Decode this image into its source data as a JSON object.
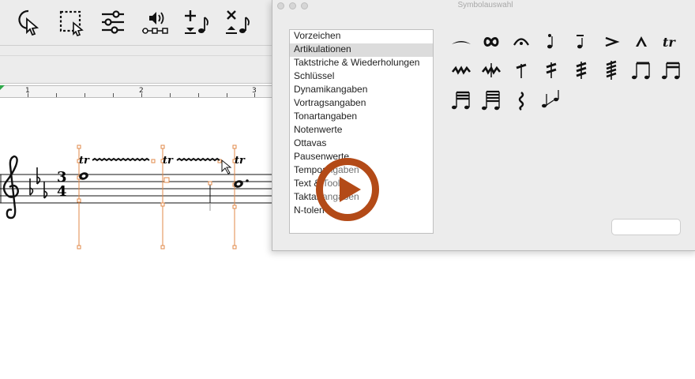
{
  "toolbar": {
    "tools": [
      {
        "icon": "cursor-select-icon"
      },
      {
        "icon": "marquee-select-icon"
      },
      {
        "icon": "sliders-icon"
      },
      {
        "icon": "playback-volume-icon"
      },
      {
        "icon": "add-note-icon"
      },
      {
        "icon": "delete-note-icon"
      }
    ]
  },
  "ruler": {
    "measures": [
      "1",
      "2",
      "3"
    ]
  },
  "score": {
    "trill_label": "tr",
    "time_signature_top": "3",
    "time_signature_bottom": "4",
    "selection_color": "#e08a4a"
  },
  "palette": {
    "title": "Symbolauswahl",
    "categories": [
      "Vorzeichen",
      "Artikulationen",
      "Taktstriche & Wiederholungen",
      "Schlüssel",
      "Dynamikangaben",
      "Vortragsangaben",
      "Tonartangaben",
      "Notenwerte",
      "Ottavas",
      "Pausenwerte",
      "Tempoangaben",
      "Text & Tools",
      "Taktartangaben",
      "N-tolen"
    ],
    "selected_category": "Artikulationen",
    "symbols": [
      "slur-icon",
      "turn-icon",
      "fermata-icon",
      "staccato-icon",
      "tenuto-icon",
      "accent-icon",
      "marcato-icon",
      "trill-icon",
      "short-trill-icon",
      "mordent-icon",
      "tremolo-one-stroke-icon",
      "tremolo-two-strokes-icon",
      "tremolo-three-strokes-icon",
      "tremolo-four-strokes-icon",
      "beamed-eighths-icon",
      "beamed-sixteenths-icon",
      "beamed-thirty-seconds-icon",
      "beamed-sixty-fourths-icon",
      "arpeggio-icon",
      "glissando-icon"
    ],
    "button_label": ""
  },
  "overlay": {
    "icon": "play-icon",
    "color": "#b34a17"
  }
}
